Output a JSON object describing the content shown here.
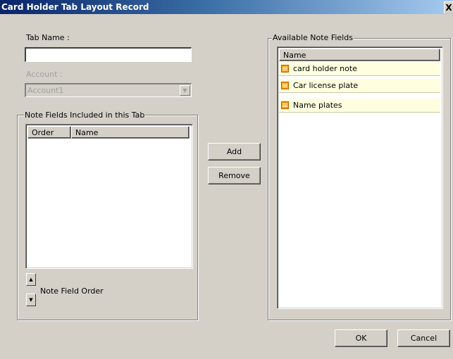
{
  "window": {
    "title": "Card Holder Tab Layout Record",
    "close_label": "X"
  },
  "tab_name": {
    "label": "Tab Name :",
    "value": ""
  },
  "account": {
    "label": "Account :",
    "value": "Account1"
  },
  "included_group": {
    "title": "Note Fields Included in this Tab",
    "columns": [
      "Order",
      "Name"
    ],
    "rows": []
  },
  "order_control": {
    "label": "Note Field Order",
    "up_glyph": "▲",
    "down_glyph": "▼"
  },
  "buttons": {
    "add": "Add",
    "remove": "Remove",
    "ok": "OK",
    "cancel": "Cancel"
  },
  "available_group": {
    "title": "Available Note Fields",
    "columns": [
      "Name"
    ],
    "rows": [
      {
        "name": "card holder note",
        "icon": "note-field-icon"
      },
      {
        "name": "Car license plate",
        "icon": "note-field-icon"
      },
      {
        "name": "Name plates",
        "icon": "note-field-icon"
      }
    ]
  },
  "colors": {
    "title_start": "#0a246a",
    "title_end": "#a6caf0",
    "face": "#d4d0c8",
    "row_highlight": "#ffffe0"
  }
}
